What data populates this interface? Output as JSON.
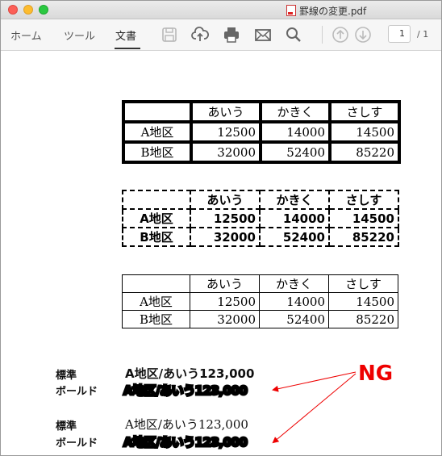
{
  "window": {
    "title": "罫線の変更.pdf"
  },
  "toolbar": {
    "tabs": [
      "ホーム",
      "ツール",
      "文書"
    ],
    "active_tab": "文書",
    "icons": [
      "save-icon",
      "upload-cloud-icon",
      "print-icon",
      "mail-icon",
      "search-icon",
      "page-up-icon",
      "page-down-icon"
    ],
    "page_current": "1",
    "page_total": "/ 1"
  },
  "tables": [
    {
      "style": "thick-solid",
      "headers": [
        "",
        "あいう",
        "かきく",
        "さしす"
      ],
      "rows": [
        [
          "A地区",
          "12500",
          "14000",
          "14500"
        ],
        [
          "B地区",
          "32000",
          "52400",
          "85220"
        ]
      ]
    },
    {
      "style": "dashed-bold",
      "headers": [
        "",
        "あいう",
        "かきく",
        "さしす"
      ],
      "rows": [
        [
          "A地区",
          "12500",
          "14000",
          "14500"
        ],
        [
          "B地区",
          "32000",
          "52400",
          "85220"
        ]
      ]
    },
    {
      "style": "thin-solid",
      "headers": [
        "",
        "あいう",
        "かきく",
        "さしす"
      ],
      "rows": [
        [
          "A地区",
          "12500",
          "14000",
          "14500"
        ],
        [
          "B地区",
          "32000",
          "52400",
          "85220"
        ]
      ]
    }
  ],
  "samples": [
    {
      "standard_label": "標準",
      "standard_text": "A地区/あいう123,000",
      "bold_label": "ボールド",
      "bold_text": "A地区/あいう123,000"
    },
    {
      "standard_label": "標準",
      "standard_text": "A地区/あいう123,000",
      "bold_label": "ボールド",
      "bold_text": "A地区/あいう123,000"
    }
  ],
  "annotation": {
    "text": "NG",
    "color": "#e00000"
  },
  "colors": {
    "accent_ng": "#e00000",
    "toolbar_bg": "#f6f6f6"
  }
}
